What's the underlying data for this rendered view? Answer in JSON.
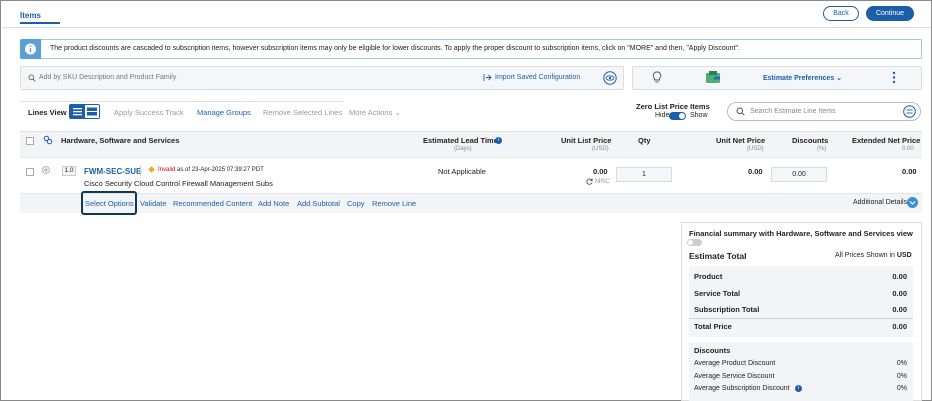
{
  "tabs": {
    "items": "Items"
  },
  "header_buttons": {
    "back": "Back",
    "continue": "Continue"
  },
  "banner": {
    "text": "The product discounts are cascaded to subscription items, however subscription items may only be eligible for lower discounts. To apply the proper discount to subscription items, click on \"MORE\" and then, \"Apply Discount\"."
  },
  "search_bar": {
    "placeholder": "Add by SKU Description and Product Family",
    "import_label": "Import Saved Configuration"
  },
  "tools": {
    "estimate_preferences": "Estimate Preferences"
  },
  "toolbar": {
    "lines_view": "Lines View",
    "apply_success_track": "Apply Success Track",
    "manage_groups": "Manage Groups",
    "remove_selected_lines": "Remove Selected Lines",
    "more_actions": "More Actions",
    "zero_list_price": "Zero List Price Items",
    "hide": "Hide",
    "show": "Show",
    "search_placeholder": "Search Estimate Line Items"
  },
  "table": {
    "headers": {
      "product": "Hardware, Software and Services",
      "lead_time": "Estimated Lead Time",
      "lead_time_unit": "(Days)",
      "unit_list_price": "Unit List Price",
      "unit_list_price_unit": "(USD)",
      "qty": "Qty",
      "unit_net_price": "Unit Net Price",
      "unit_net_price_unit": "(USD)",
      "discounts": "Discounts",
      "discounts_unit": "(%)",
      "extended_net_price": "Extended Net Price",
      "extended_net_price_unit": "(USD)"
    },
    "row": {
      "version": "1.0",
      "sku": "FWM-SEC-SUB",
      "invalid": "Invalid",
      "invalid_date": "as of 23-Apr-2025 07:39:27 PDT",
      "description": "Cisco Security Cloud Control Firewall Management Subs",
      "lead_time": "Not Applicable",
      "unit_list_price": "0.00",
      "mrc": "MRC",
      "qty": "1",
      "unit_net_price": "0.00",
      "discount": "0.00",
      "extended_net_price": "0.00"
    },
    "totals": {
      "extended_net_price": "0.00"
    }
  },
  "action_bar": {
    "select_options": "Select Options",
    "validate": "Validate",
    "recommended_content": "Recommended Content",
    "add_note": "Add Note",
    "add_subtotal": "Add Subtotal",
    "copy": "Copy",
    "remove_line": "Remove Line",
    "additional_details": "Additional Details"
  },
  "financial_summary": {
    "title": "Financial summary with Hardware, Software and Services view",
    "estimate_total": "Estimate Total",
    "prices_shown_in": "All Prices Shown in",
    "currency": "USD",
    "rows": [
      {
        "label": "Product",
        "value": "0.00"
      },
      {
        "label": "Service Total",
        "value": "0.00"
      },
      {
        "label": "Subscription Total",
        "value": "0.00"
      },
      {
        "label": "Total Price",
        "value": "0.00"
      }
    ],
    "discounts_heading": "Discounts",
    "discounts": [
      {
        "label": "Average Product Discount",
        "value": "0%"
      },
      {
        "label": "Average Service Discount",
        "value": "0%"
      },
      {
        "label": "Average Subscription Discount",
        "value": "0%"
      }
    ]
  },
  "colors": {
    "brand": "#1b5fa8",
    "invalid": "#d0021b",
    "warning": "#f5a623"
  }
}
